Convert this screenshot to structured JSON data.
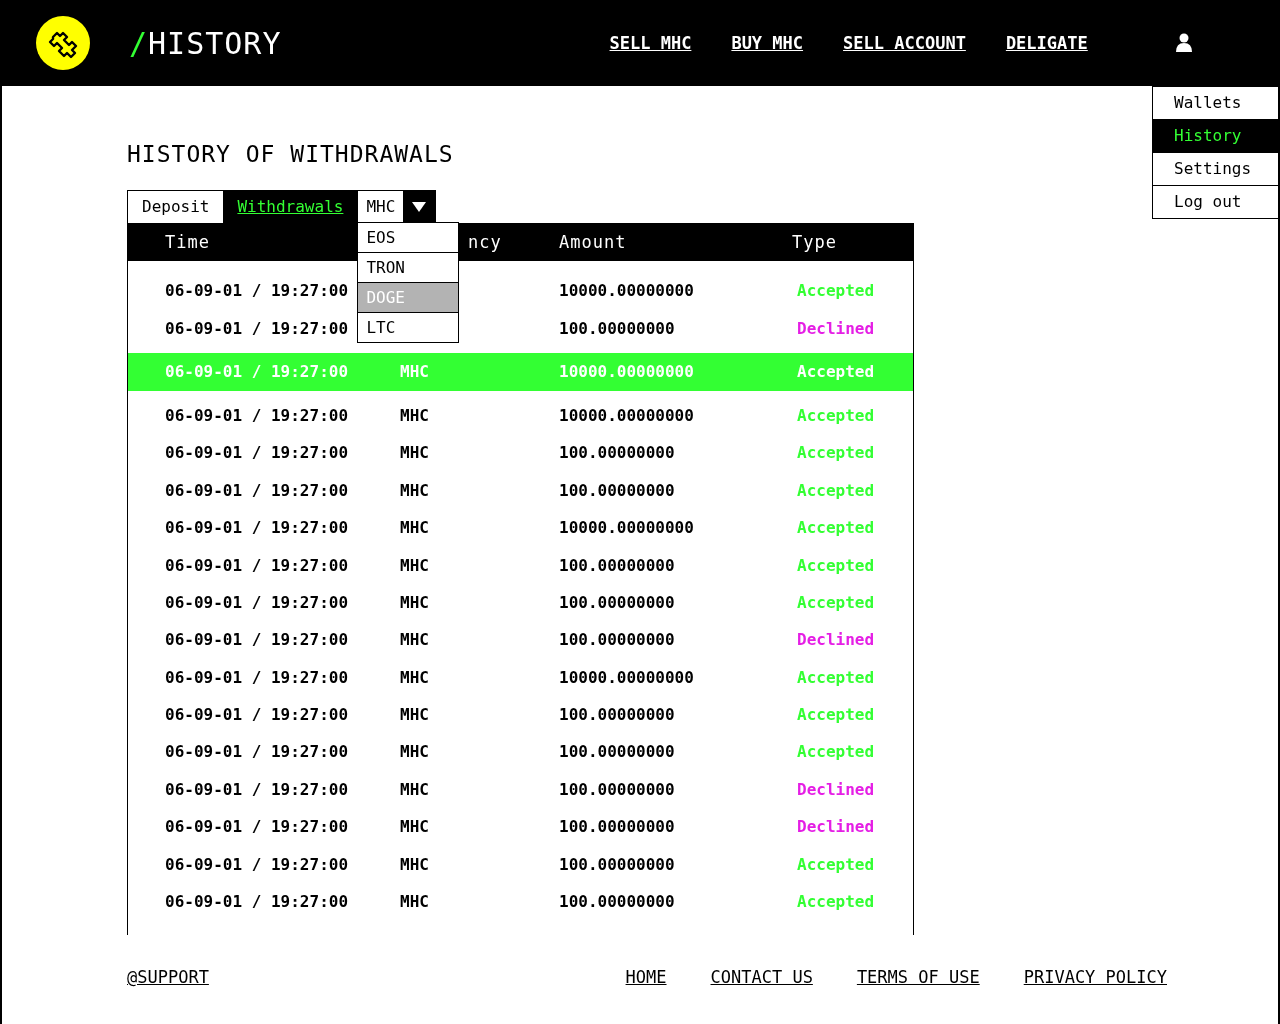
{
  "header": {
    "title_slash": "/",
    "title": "HISTORY",
    "nav": [
      "SELL MHC",
      "BUY MHC",
      "SELL ACCOUNT",
      "DELIGATE"
    ]
  },
  "user_menu": [
    {
      "label": "Wallets",
      "selected": false
    },
    {
      "label": "History",
      "selected": true
    },
    {
      "label": "Settings",
      "selected": false
    },
    {
      "label": "Log out",
      "selected": false
    }
  ],
  "page_title": "HISTORY OF WITHDRAWALS",
  "tabs": [
    {
      "label": "Deposit",
      "selected": false
    },
    {
      "label": "Withdrawals",
      "selected": true
    }
  ],
  "currency_select": {
    "value": "MHC",
    "expanded": true,
    "options": [
      {
        "label": "EOS",
        "highlighted": false
      },
      {
        "label": "TRON",
        "highlighted": false
      },
      {
        "label": "DOGE",
        "highlighted": true
      },
      {
        "label": "LTC",
        "highlighted": false
      }
    ]
  },
  "table": {
    "columns": [
      "Time",
      "ncy",
      "Amount",
      "Type"
    ],
    "rows": [
      {
        "time": "06-09-01 / 19:27:00",
        "amount": "10000.00000000",
        "type": "Accepted",
        "color": "#33ff33",
        "selected": false
      },
      {
        "time": "06-09-01 / 19:27:00",
        "amount": "100.00000000",
        "type": "Declined",
        "color": "#e51ee5",
        "selected": false
      },
      {
        "time": "06-09-01 / 19:27:00",
        "currency": "MHC",
        "amount": "10000.00000000",
        "type": "Accepted",
        "selected": true
      },
      {
        "time": "06-09-01 / 19:27:00",
        "currency": "MHC",
        "amount": "10000.00000000",
        "type": "Accepted",
        "color": "#33ff33",
        "selected": false
      },
      {
        "time": "06-09-01 / 19:27:00",
        "currency": "MHC",
        "amount": "100.00000000",
        "type": "Accepted",
        "color": "#33ff33",
        "selected": false
      },
      {
        "time": "06-09-01 / 19:27:00",
        "currency": "MHC",
        "amount": "100.00000000",
        "type": "Accepted",
        "color": "#33ff33",
        "selected": false
      },
      {
        "time": "06-09-01 / 19:27:00",
        "currency": "MHC",
        "amount": "10000.00000000",
        "type": "Accepted",
        "color": "#33ff33",
        "selected": false
      },
      {
        "time": "06-09-01 / 19:27:00",
        "currency": "MHC",
        "amount": "100.00000000",
        "type": "Accepted",
        "color": "#33ff33",
        "selected": false
      },
      {
        "time": "06-09-01 / 19:27:00",
        "currency": "MHC",
        "amount": "100.00000000",
        "type": "Accepted",
        "color": "#33ff33",
        "selected": false
      },
      {
        "time": "06-09-01 / 19:27:00",
        "currency": "MHC",
        "amount": "100.00000000",
        "type": "Declined",
        "color": "#e51ee5",
        "selected": false
      },
      {
        "time": "06-09-01 / 19:27:00",
        "currency": "MHC",
        "amount": "10000.00000000",
        "type": "Accepted",
        "color": "#33ff33",
        "selected": false
      },
      {
        "time": "06-09-01 / 19:27:00",
        "currency": "MHC",
        "amount": "100.00000000",
        "type": "Accepted",
        "color": "#33ff33",
        "selected": false
      },
      {
        "time": "06-09-01 / 19:27:00",
        "currency": "MHC",
        "amount": "100.00000000",
        "type": "Accepted",
        "color": "#33ff33",
        "selected": false
      },
      {
        "time": "06-09-01 / 19:27:00",
        "currency": "MHC",
        "amount": "100.00000000",
        "type": "Declined",
        "color": "#e51ee5",
        "selected": false
      },
      {
        "time": "06-09-01 / 19:27:00",
        "currency": "MHC",
        "amount": "100.00000000",
        "type": "Declined",
        "color": "#e51ee5",
        "selected": false
      },
      {
        "time": "06-09-01 / 19:27:00",
        "currency": "MHC",
        "amount": "100.00000000",
        "type": "Accepted",
        "color": "#33ff33",
        "selected": false
      },
      {
        "time": "06-09-01 / 19:27:00",
        "currency": "MHC",
        "amount": "100.00000000",
        "type": "Accepted",
        "color": "#33ff33",
        "selected": false
      }
    ]
  },
  "footer": {
    "support": "@SUPPORT",
    "links": [
      "HOME",
      "CONTACT US",
      "TERMS OF USE",
      "PRIVACY POLICY"
    ]
  }
}
